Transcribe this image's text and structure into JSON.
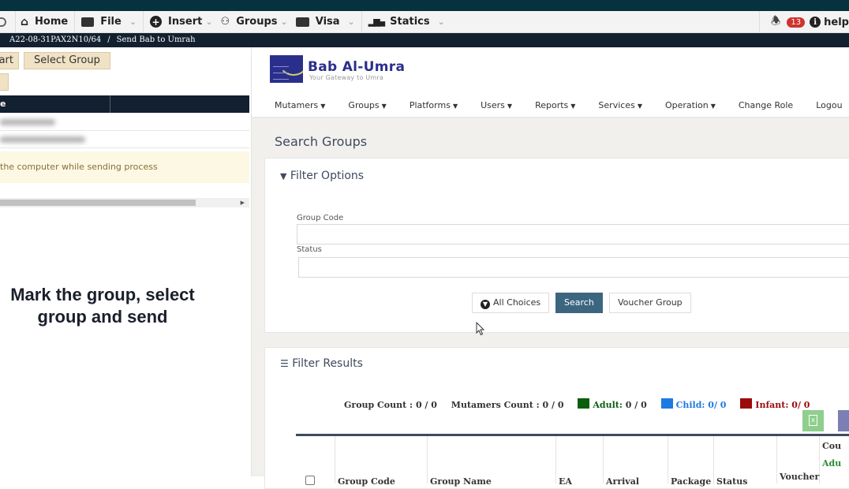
{
  "menubar": {
    "items": [
      {
        "label": "Home",
        "icon": "home-icon"
      },
      {
        "label": "File",
        "icon": "file-icon"
      },
      {
        "label": "Insert",
        "icon": "plus-circle-icon"
      },
      {
        "label": "Groups",
        "icon": "users-icon"
      },
      {
        "label": "Visa",
        "icon": "briefcase-icon"
      },
      {
        "label": "Statics",
        "icon": "bar-chart-icon"
      }
    ],
    "notification_count": "13",
    "help_label": "help"
  },
  "breadcrumb": {
    "items": [
      "A22-08-31PAX2N10/64",
      "Send Bab to Umrah"
    ],
    "separator": "/"
  },
  "left_panel": {
    "buttons": {
      "start_partial": "art",
      "select_group": "Select Group",
      "extra": ""
    },
    "table_header": {
      "col1_partial": "e",
      "col2": ""
    },
    "warning_partial": "the computer while sending process",
    "caption": "Mark the group, select group and send"
  },
  "brand": {
    "name": "Bab Al-Umra",
    "tagline": "Your Gateway to Umra"
  },
  "navbar": {
    "items": [
      {
        "label": "Mutamers",
        "dropdown": true
      },
      {
        "label": "Groups",
        "dropdown": true
      },
      {
        "label": "Platforms",
        "dropdown": true
      },
      {
        "label": "Users",
        "dropdown": true
      },
      {
        "label": "Reports",
        "dropdown": true
      },
      {
        "label": "Services",
        "dropdown": true
      },
      {
        "label": "Operation",
        "dropdown": true
      },
      {
        "label": "Change Role",
        "dropdown": false
      },
      {
        "label": "Logou",
        "dropdown": false
      }
    ]
  },
  "page_title": "Search Groups",
  "filter_options": {
    "title": "Filter Options",
    "group_code_label": "Group Code",
    "group_code_value": "",
    "status_label": "Status",
    "status_value": "",
    "all_choices_label": "All Choices",
    "search_label": "Search",
    "voucher_group_label": "Voucher Group"
  },
  "filter_results": {
    "title": "Filter Results",
    "group_count_label": "Group Count :",
    "group_count_value": "0 / 0",
    "mutamers_count_label": "Mutamers Count :",
    "mutamers_count_value": "0 / 0",
    "adult_label": "Adult:",
    "adult_value": "0 / 0",
    "child_label": "Child:",
    "child_value": "0/ 0",
    "infant_label": "Infant:",
    "infant_value": "0/ 0",
    "colors": {
      "adult": "#0b5e0b",
      "child": "#1e7ae0",
      "infant": "#9b0a0a"
    },
    "columns": [
      "",
      "Group Code",
      "Group Name",
      "EA",
      "Arrival",
      "Package",
      "Status",
      "Voucher",
      "Cou"
    ],
    "count_sub_label": "Adu"
  }
}
